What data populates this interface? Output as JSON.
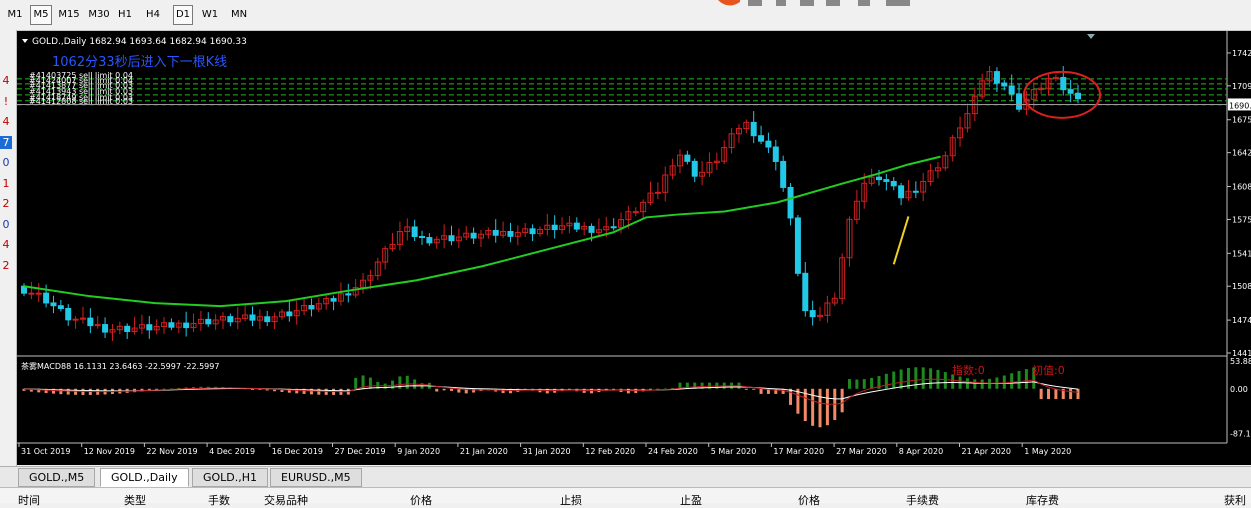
{
  "toolbar": {
    "timeframes": [
      "M1",
      "M5",
      "M15",
      "M30",
      "H1",
      "H4",
      "D1",
      "W1",
      "MN"
    ],
    "active": "D1",
    "selected": "M5"
  },
  "left_strip": [
    "4",
    "!",
    "4",
    "7",
    "0",
    "1",
    "2",
    "0",
    "4",
    "2"
  ],
  "colors": {
    "bg": "#000000",
    "bull": "#d02020",
    "bear": "#22c8e8",
    "ma": "#22cc22",
    "order_line": "#22b522",
    "macd_pos": "#1d8a1d",
    "macd_neg": "#f28a66",
    "signal": "#c02020",
    "macd_line": "#ffffff",
    "axis_text": "#ffffff",
    "circle": "#e02020",
    "countdown": "#2a55ff",
    "annot": "#d01010"
  },
  "chart_data": {
    "type": "candlestick",
    "symbol_label": "GOLD.,Daily",
    "ohlc_label": "1682.94 1693.64 1682.94 1690.33",
    "countdown": "1062分33秒后进入下一根K线",
    "orders": [
      {
        "label": "#41403725 sell limit 0.04",
        "price": 1716
      },
      {
        "label": "#41424007 sell limit 0.04",
        "price": 1711
      },
      {
        "label": "#41413877 sell limit 0.03",
        "price": 1706
      },
      {
        "label": "#41413943 sell limit 0.03",
        "price": 1700
      },
      {
        "label": "#41418749 sell limit 0.03",
        "price": 1694
      },
      {
        "label": "#41412808 sell limit 0.03",
        "price": 1690
      }
    ],
    "current_price": "1690.33",
    "y_ticks": [
      "1742.00",
      "1709.00",
      "1675.00",
      "1642.00",
      "1608.00",
      "1575.00",
      "1541.00",
      "1508.00",
      "1474.00",
      "1441.00"
    ],
    "ylim": [
      1441,
      1758
    ],
    "x_labels": [
      "31 Oct 2019",
      "12 Nov 2019",
      "22 Nov 2019",
      "4 Dec 2019",
      "16 Dec 2019",
      "27 Dec 2019",
      "9 Jan 2020",
      "21 Jan 2020",
      "31 Jan 2020",
      "12 Feb 2020",
      "24 Feb 2020",
      "5 Mar 2020",
      "17 Mar 2020",
      "27 Mar 2020",
      "8 Apr 2020",
      "21 Apr 2020",
      "1 May 2020"
    ],
    "ma_points": [
      [
        0,
        1508
      ],
      [
        10,
        1498
      ],
      [
        20,
        1491
      ],
      [
        30,
        1488
      ],
      [
        40,
        1493
      ],
      [
        50,
        1504
      ],
      [
        60,
        1514
      ],
      [
        70,
        1528
      ],
      [
        80,
        1545
      ],
      [
        90,
        1562
      ],
      [
        95,
        1577
      ],
      [
        100,
        1580
      ],
      [
        107,
        1583
      ],
      [
        115,
        1592
      ],
      [
        125,
        1611
      ],
      [
        130,
        1620
      ],
      [
        135,
        1630
      ],
      [
        140,
        1638
      ]
    ],
    "macd": {
      "label": "茶雾MACD88 16.1131 23.6463 -22.5997 -22.5997",
      "ticks": [
        "53.8884",
        "0.00",
        "-87.1272"
      ],
      "ylim": [
        -90,
        58
      ],
      "annot1": "指数:0",
      "annot2": "初值:0"
    }
  },
  "tabs": [
    "GOLD.,M5",
    "GOLD.,Daily",
    "GOLD.,H1",
    "EURUSD.,M5"
  ],
  "active_tab": "GOLD.,Daily",
  "bottom_header": [
    "时间",
    "类型",
    "手数",
    "交易品种",
    "价格",
    "止损",
    "止盈",
    "价格",
    "手续费",
    "库存费",
    "获利"
  ]
}
